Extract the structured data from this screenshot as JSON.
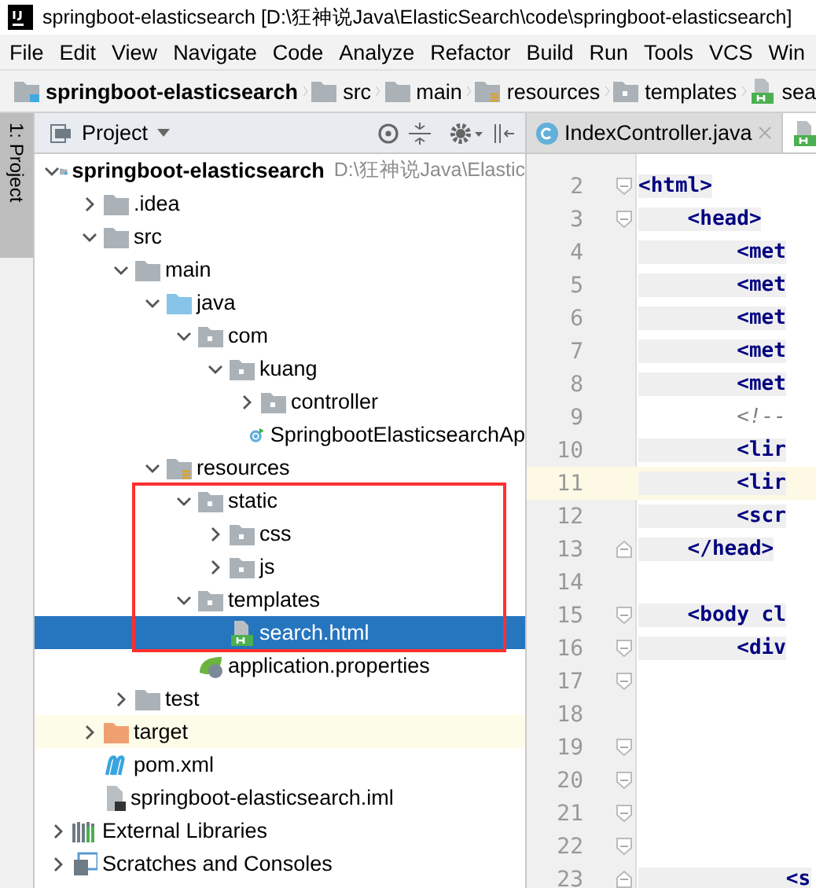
{
  "window": {
    "title": "springboot-elasticsearch [D:\\狂神说Java\\ElasticSearch\\code\\springboot-elasticsearch]"
  },
  "menu": [
    "File",
    "Edit",
    "View",
    "Navigate",
    "Code",
    "Analyze",
    "Refactor",
    "Build",
    "Run",
    "Tools",
    "VCS",
    "Win"
  ],
  "breadcrumb": [
    {
      "label": "springboot-elasticsearch",
      "kind": "module"
    },
    {
      "label": "src",
      "kind": "folder"
    },
    {
      "label": "main",
      "kind": "folder"
    },
    {
      "label": "resources",
      "kind": "resources-folder"
    },
    {
      "label": "templates",
      "kind": "package"
    },
    {
      "label": "sea",
      "kind": "html"
    }
  ],
  "tool_stripe": {
    "label": "1: Project",
    "selected": true
  },
  "project_panel": {
    "title": "Project",
    "tree": [
      {
        "name": "springboot-elasticsearch",
        "path": "D:\\狂神说Java\\Elastic",
        "kind": "module",
        "expanded": true,
        "selected": false,
        "children": [
          {
            "name": ".idea",
            "kind": "folder",
            "expanded": false,
            "selected": false
          },
          {
            "name": "src",
            "kind": "folder",
            "expanded": true,
            "selected": false,
            "children": [
              {
                "name": "main",
                "kind": "folder",
                "expanded": true,
                "selected": false,
                "children": [
                  {
                    "name": "java",
                    "kind": "source-folder",
                    "expanded": true,
                    "selected": false,
                    "children": [
                      {
                        "name": "com",
                        "kind": "package",
                        "expanded": true,
                        "selected": false,
                        "children": [
                          {
                            "name": "kuang",
                            "kind": "package",
                            "expanded": true,
                            "selected": false,
                            "children": [
                              {
                                "name": "controller",
                                "kind": "package",
                                "expanded": false,
                                "selected": false
                              },
                              {
                                "name": "SpringbootElasticsearchAp",
                                "kind": "spring-class",
                                "selected": false
                              }
                            ]
                          }
                        ]
                      }
                    ]
                  },
                  {
                    "name": "resources",
                    "kind": "resources-folder",
                    "expanded": true,
                    "selected": false,
                    "children": [
                      {
                        "name": "static",
                        "kind": "package",
                        "expanded": true,
                        "selected": false,
                        "children": [
                          {
                            "name": "css",
                            "kind": "package",
                            "expanded": false,
                            "selected": false
                          },
                          {
                            "name": "js",
                            "kind": "package",
                            "expanded": false,
                            "selected": false
                          }
                        ]
                      },
                      {
                        "name": "templates",
                        "kind": "package",
                        "expanded": true,
                        "selected": false,
                        "children": [
                          {
                            "name": "search.html",
                            "kind": "html",
                            "selected": true
                          }
                        ]
                      },
                      {
                        "name": "application.properties",
                        "kind": "spring-properties",
                        "selected": false
                      }
                    ]
                  }
                ]
              },
              {
                "name": "test",
                "kind": "folder",
                "expanded": false,
                "selected": false
              }
            ]
          },
          {
            "name": "target",
            "kind": "excluded-folder",
            "expanded": false,
            "selected": false
          },
          {
            "name": "pom.xml",
            "kind": "maven",
            "selected": false
          },
          {
            "name": "springboot-elasticsearch.iml",
            "kind": "iml",
            "selected": false
          }
        ]
      },
      {
        "name": "External Libraries",
        "kind": "libraries",
        "expanded": false,
        "selected": false
      },
      {
        "name": "Scratches and Consoles",
        "kind": "scratches",
        "expanded": false,
        "selected": false
      }
    ]
  },
  "editor": {
    "tabs": [
      {
        "label": "IndexController.java",
        "kind": "class",
        "selected": false
      },
      {
        "kind": "html",
        "selected": true
      }
    ],
    "lines": [
      {
        "number": "2",
        "code": "<html>",
        "fold_marker": {
          "kind": "start"
        },
        "current": false
      },
      {
        "number": "3",
        "code": "    <head>",
        "fold_marker": {
          "kind": "start"
        },
        "current": false
      },
      {
        "number": "4",
        "code": "        <met",
        "current": false
      },
      {
        "number": "5",
        "code": "        <met",
        "current": false
      },
      {
        "number": "6",
        "code": "        <met",
        "current": false
      },
      {
        "number": "7",
        "code": "        <met",
        "current": false
      },
      {
        "number": "8",
        "code": "        <met",
        "current": false
      },
      {
        "number": "9",
        "code": "        <!--",
        "kind": "comment",
        "current": false
      },
      {
        "number": "10",
        "code": "        <lir",
        "current": false
      },
      {
        "number": "11",
        "code": "        <lir",
        "current": true
      },
      {
        "number": "12",
        "code": "        <scr",
        "current": false
      },
      {
        "number": "13",
        "code": "    </head>",
        "fold_marker": {
          "kind": "end"
        },
        "current": false
      },
      {
        "number": "14",
        "current": false
      },
      {
        "number": "15",
        "code": "    <body cl",
        "fold_marker": {
          "kind": "start"
        },
        "current": false
      },
      {
        "number": "16",
        "code": "        <div",
        "fold_marker": {
          "kind": "start"
        },
        "current": false
      },
      {
        "number": "17",
        "fold_marker": {
          "kind": "start"
        },
        "current": false
      },
      {
        "number": "18",
        "current": false
      },
      {
        "number": "19",
        "fold_marker": {
          "kind": "start"
        },
        "current": false
      },
      {
        "number": "20",
        "fold_marker": {
          "kind": "start"
        },
        "current": false
      },
      {
        "number": "21",
        "fold_marker": {
          "kind": "start"
        },
        "current": false
      },
      {
        "number": "22",
        "fold_marker": {
          "kind": "start"
        },
        "current": false
      },
      {
        "number": "23",
        "code": "            <s",
        "fold_marker": {
          "kind": "end"
        },
        "current": false
      }
    ]
  }
}
